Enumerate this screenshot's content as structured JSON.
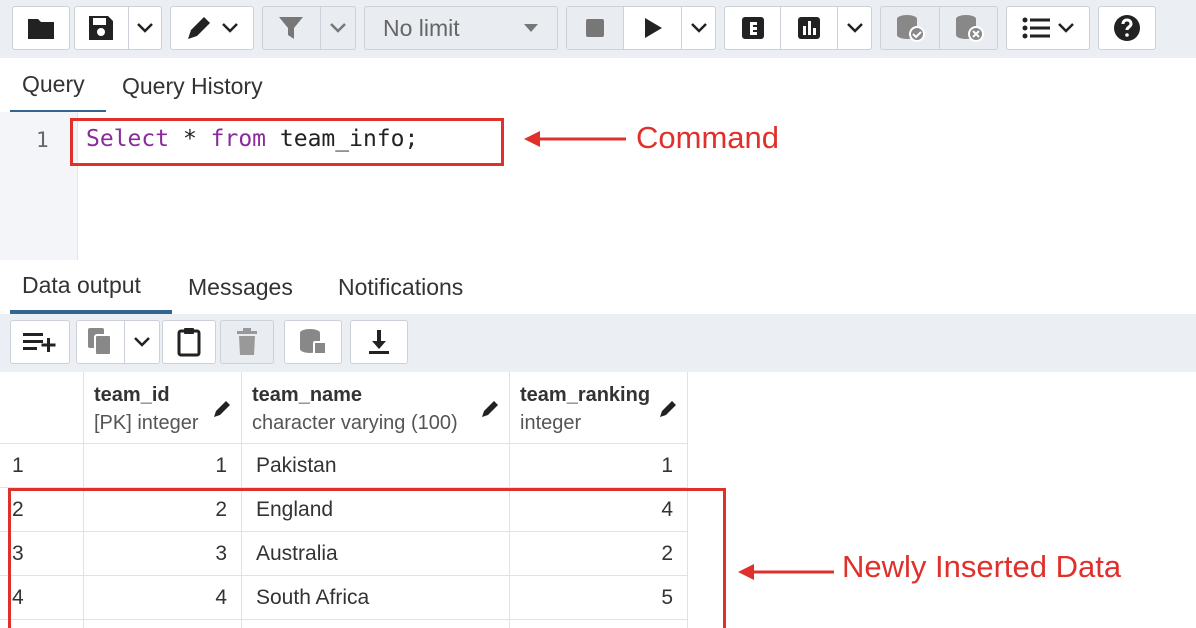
{
  "toolbar": {
    "limit_select": {
      "value": "No limit"
    },
    "icons": [
      "folder-icon",
      "save-icon",
      "chevron-down-icon",
      "edit-pencil-icon",
      "filter-icon",
      "stop-icon",
      "play-icon",
      "explain-icon",
      "explain-analyze-icon",
      "commit-icon",
      "rollback-icon",
      "macros-icon",
      "help-icon"
    ]
  },
  "query_tabs": [
    {
      "label": "Query",
      "active": true
    },
    {
      "label": "Query History",
      "active": false
    }
  ],
  "editor": {
    "line_number": "1",
    "tokens": {
      "kw1": "Select",
      "mid": " * ",
      "kw2": "from",
      "rest": " team_info;"
    }
  },
  "annotations": {
    "command": "Command",
    "newly_inserted": "Newly Inserted Data",
    "color": "#e0302c"
  },
  "output_tabs": [
    {
      "label": "Data output",
      "active": true
    },
    {
      "label": "Messages",
      "active": false
    },
    {
      "label": "Notifications",
      "active": false
    }
  ],
  "grid": {
    "columns": [
      {
        "name": "team_id",
        "type": "[PK] integer"
      },
      {
        "name": "team_name",
        "type": "character varying (100)"
      },
      {
        "name": "team_ranking",
        "type": "integer"
      }
    ],
    "rows": [
      {
        "row": "1",
        "team_id": "1",
        "team_name": "Pakistan",
        "team_ranking": "1"
      },
      {
        "row": "2",
        "team_id": "2",
        "team_name": "England",
        "team_ranking": "4"
      },
      {
        "row": "3",
        "team_id": "3",
        "team_name": "Australia",
        "team_ranking": "2"
      },
      {
        "row": "4",
        "team_id": "4",
        "team_name": "South Africa",
        "team_ranking": "5"
      }
    ]
  },
  "colors": {
    "keyword": "#8a2b9c",
    "active_tab": "#326690",
    "toolbar_bg": "#ebeef3"
  }
}
